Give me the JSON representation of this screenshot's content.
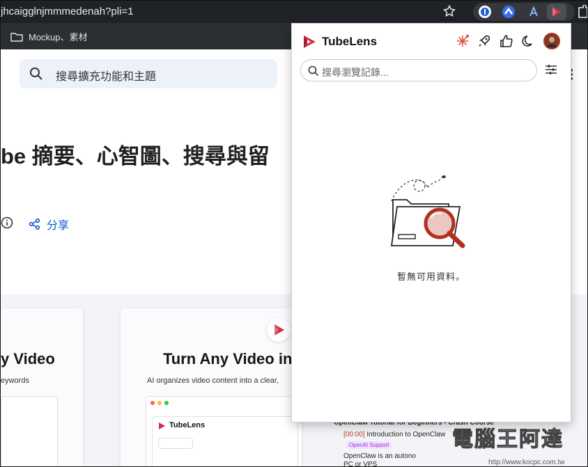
{
  "browser": {
    "url": "jhcaigglnjmmmedenah?pli=1",
    "bookmark_label": "Mockup、素材"
  },
  "page": {
    "search_placeholder": "搜尋擴充功能和主題",
    "title_fragment": "be 摘要、心智圖、搜尋與留",
    "share_label": "分享",
    "card1": {
      "title_fragment": "y Video",
      "subtitle_fragment": "eywords"
    },
    "card2": {
      "title_fragment": "Turn Any Video in",
      "subtitle_fragment": "AI organizes video content into a clear,",
      "mini_app_name": "TubeLens"
    },
    "card3": {
      "heading": "OpenClaw Tutorial for Beginners - Crash Course",
      "timestamp": "[00:00]",
      "chapter": "Introduction to OpenClaw",
      "tag": "OpenAI Support",
      "snippet": "OpenClaw is an autono",
      "snippet2": "PC or VPS"
    },
    "watermark": "電腦王阿達",
    "watermark_url": "http://www.kocpc.com.tw"
  },
  "popup": {
    "app_name": "TubeLens",
    "search_placeholder": "搜尋瀏覽記錄...",
    "empty_message": "暫無可用資料。"
  },
  "colors": {
    "brand": "#d1304a",
    "accent_red": "#c0392b",
    "chrome_dark": "#1f2226",
    "share_blue": "#0b57d0"
  }
}
